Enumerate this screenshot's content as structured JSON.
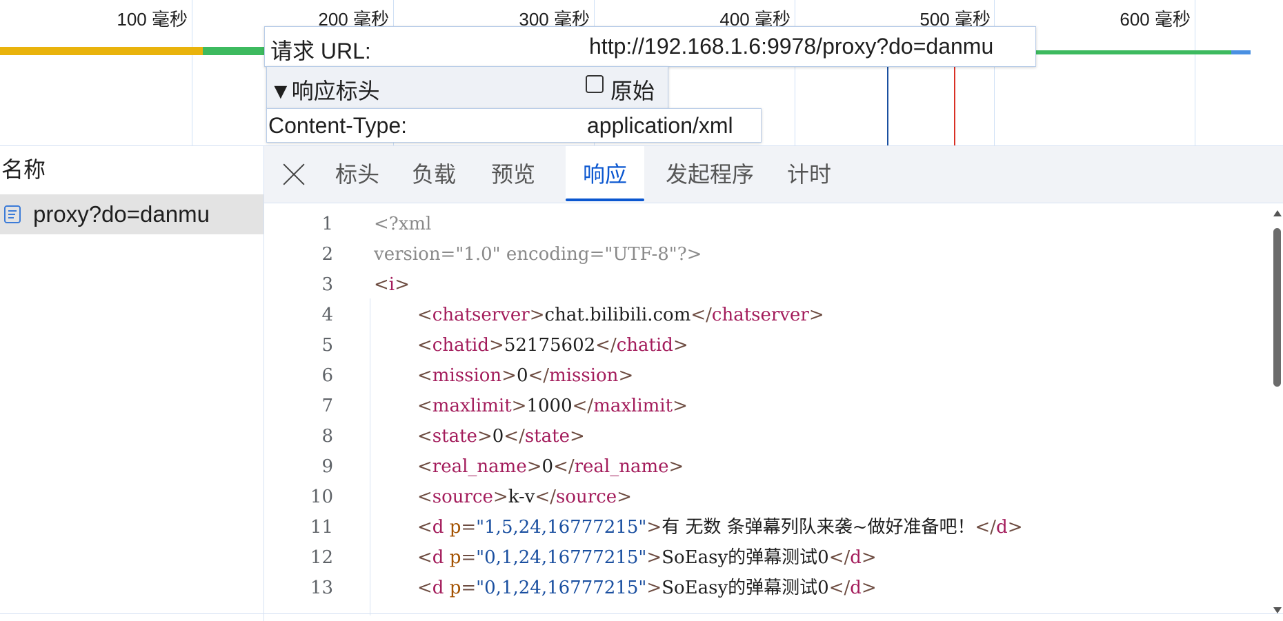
{
  "timeline": {
    "ticks": [
      "100  毫秒",
      "200  毫秒",
      "300  毫秒",
      "400  毫秒",
      "500  毫秒",
      "600  毫秒"
    ],
    "colors": {
      "queue": "#e9b30c",
      "download": "#3dba5f",
      "end": "#4a90e2",
      "marker_blue": "#1a4fa0",
      "marker_red": "#d93025"
    }
  },
  "tooltip": {
    "url_label": "请求 URL:",
    "url_value": "http://192.168.1.6:9978/proxy?do=danmu",
    "section_label": "▼响应标头",
    "raw_label": "原始",
    "header_name": "Content-Type:",
    "header_value": "application/xml"
  },
  "left_panel": {
    "column_header": "名称",
    "requests": [
      {
        "name": "proxy?do=danmu"
      }
    ]
  },
  "tabs": [
    {
      "label": "标头"
    },
    {
      "label": "负载"
    },
    {
      "label": "预览"
    },
    {
      "label": "响应",
      "active": true
    },
    {
      "label": "发起程序"
    },
    {
      "label": "计时"
    }
  ],
  "code_lines": [
    {
      "n": "1",
      "decl": "<?xml"
    },
    {
      "n": "2",
      "decl": "version=\"1.0\" encoding=\"UTF-8\"?>"
    },
    {
      "n": "3",
      "open": "<",
      "tag": "i",
      "close": ">"
    },
    {
      "n": "4",
      "tag": "chatserver",
      "text": "chat.bilibili.com"
    },
    {
      "n": "5",
      "tag": "chatid",
      "text": "52175602"
    },
    {
      "n": "6",
      "tag": "mission",
      "text": "0"
    },
    {
      "n": "7",
      "tag": "maxlimit",
      "text": "1000"
    },
    {
      "n": "8",
      "tag": "state",
      "text": "0"
    },
    {
      "n": "9",
      "tag": "real_name",
      "text": "0"
    },
    {
      "n": "10",
      "tag": "source",
      "text": "k-v"
    },
    {
      "n": "11",
      "tag": "d",
      "attr": "p",
      "val": "\"1,5,24,16777215\"",
      "text": "有 无数 条弹幕列队来袭~做好准备吧！"
    },
    {
      "n": "12",
      "tag": "d",
      "attr": "p",
      "val": "\"0,1,24,16777215\"",
      "text": "SoEasy的弹幕测试0"
    },
    {
      "n": "13",
      "tag": "d",
      "attr": "p",
      "val": "\"0,1,24,16777215\"",
      "text": "SoEasy的弹幕测试0"
    }
  ]
}
